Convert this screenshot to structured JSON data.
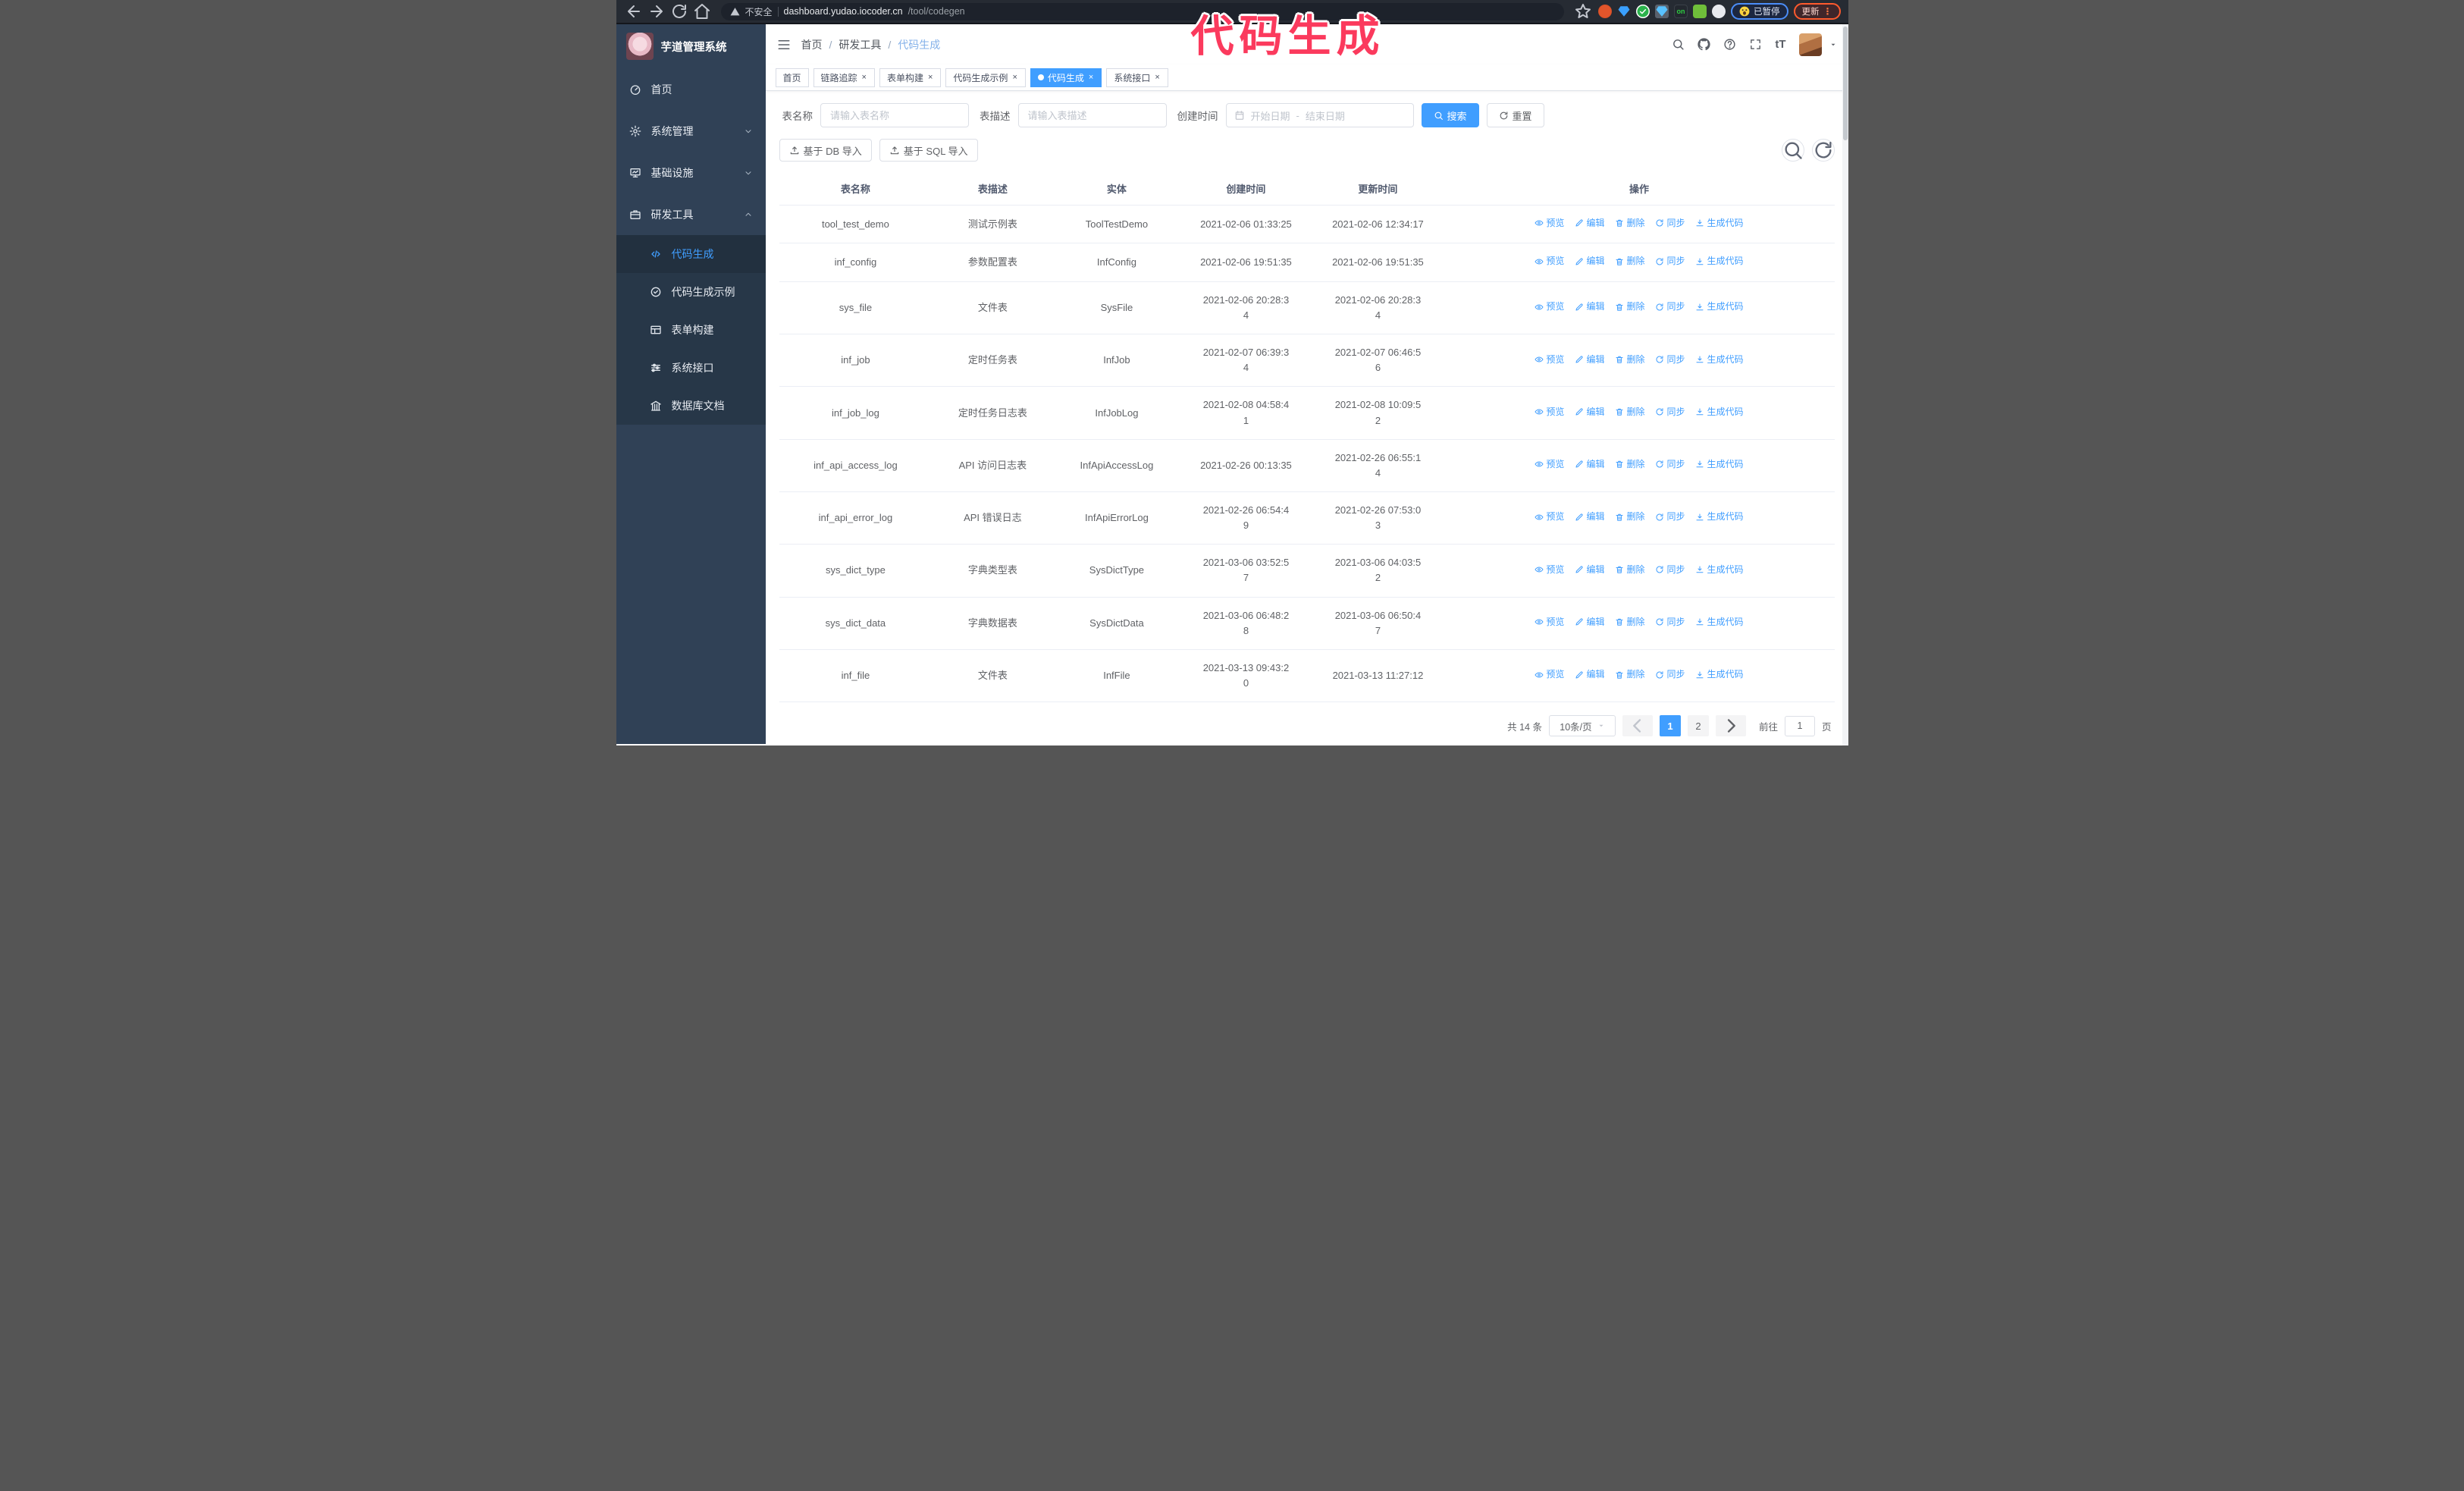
{
  "browser": {
    "insecure_label": "不安全",
    "url_host": "dashboard.yudao.iocoder.cn",
    "url_path": "/tool/codegen",
    "paused_label": "已暂停",
    "update_label": "更新"
  },
  "annotation": {
    "text": "代码生成",
    "color": "#fb3a5d"
  },
  "sidebar": {
    "title": "芋道管理系统",
    "menu": [
      {
        "key": "home",
        "icon": "dashboard-icon",
        "label": "首页",
        "chevron": ""
      },
      {
        "key": "system-management",
        "icon": "gear-icon",
        "label": "系统管理",
        "chevron": "down"
      },
      {
        "key": "infrastructure",
        "icon": "monitor-icon",
        "label": "基础设施",
        "chevron": "down"
      },
      {
        "key": "dev-tools",
        "icon": "toolbox-icon",
        "label": "研发工具",
        "chevron": "up"
      }
    ],
    "submenu": [
      {
        "key": "codegen",
        "icon": "code-icon",
        "label": "代码生成",
        "active": true
      },
      {
        "key": "codegen-example",
        "icon": "badge-check-icon",
        "label": "代码生成示例",
        "active": false
      },
      {
        "key": "form-builder",
        "icon": "form-table-icon",
        "label": "表单构建",
        "active": false
      },
      {
        "key": "system-api",
        "icon": "sliders-icon",
        "label": "系统接口",
        "active": false
      },
      {
        "key": "db-doc",
        "icon": "columns-icon",
        "label": "数据库文档",
        "active": false
      }
    ]
  },
  "navbar": {
    "breadcrumb": [
      "首页",
      "研发工具",
      "代码生成"
    ]
  },
  "tabs": [
    {
      "key": "home",
      "label": "首页",
      "closable": false,
      "active": false
    },
    {
      "key": "tracer",
      "label": "链路追踪",
      "closable": true,
      "active": false
    },
    {
      "key": "form-builder",
      "label": "表单构建",
      "closable": true,
      "active": false
    },
    {
      "key": "codegen-example",
      "label": "代码生成示例",
      "closable": true,
      "active": false
    },
    {
      "key": "codegen",
      "label": "代码生成",
      "closable": true,
      "active": true
    },
    {
      "key": "system-api",
      "label": "系统接口",
      "closable": true,
      "active": false
    }
  ],
  "filters": {
    "name_label": "表名称",
    "name_placeholder": "请输入表名称",
    "desc_label": "表描述",
    "desc_placeholder": "请输入表描述",
    "time_label": "创建时间",
    "start_placeholder": "开始日期",
    "range_separator": "-",
    "end_placeholder": "结束日期",
    "search_label": "搜索",
    "reset_label": "重置"
  },
  "toolbar": {
    "db_import_label": "基于 DB 导入",
    "sql_import_label": "基于 SQL 导入"
  },
  "table": {
    "headers": [
      "表名称",
      "表描述",
      "实体",
      "创建时间",
      "更新时间",
      "操作"
    ],
    "actions": [
      {
        "icon": "eye-icon",
        "label": "预览"
      },
      {
        "icon": "edit-icon",
        "label": "编辑"
      },
      {
        "icon": "delete-icon",
        "label": "删除"
      },
      {
        "icon": "sync-icon",
        "label": "同步"
      },
      {
        "icon": "download-icon",
        "label": "生成代码"
      }
    ],
    "rows": [
      {
        "name": "tool_test_demo",
        "desc": "测试示例表",
        "entity": "ToolTestDemo",
        "create_time": "2021-02-06 01:33:25",
        "create_wrap": false,
        "update_time": "2021-02-06 12:34:17",
        "update_wrap": false
      },
      {
        "name": "inf_config",
        "desc": "参数配置表",
        "entity": "InfConfig",
        "create_time": "2021-02-06 19:51:35",
        "create_wrap": false,
        "update_time": "2021-02-06 19:51:35",
        "update_wrap": false
      },
      {
        "name": "sys_file",
        "desc": "文件表",
        "entity": "SysFile",
        "create_time": "2021-02-06 20:28:34",
        "create_wrap": true,
        "update_time": "2021-02-06 20:28:34",
        "update_wrap": true
      },
      {
        "name": "inf_job",
        "desc": "定时任务表",
        "entity": "InfJob",
        "create_time": "2021-02-07 06:39:34",
        "create_wrap": true,
        "update_time": "2021-02-07 06:46:56",
        "update_wrap": true
      },
      {
        "name": "inf_job_log",
        "desc": "定时任务日志表",
        "entity": "InfJobLog",
        "create_time": "2021-02-08 04:58:41",
        "create_wrap": true,
        "update_time": "2021-02-08 10:09:52",
        "update_wrap": true
      },
      {
        "name": "inf_api_access_log",
        "desc": "API 访问日志表",
        "entity": "InfApiAccessLog",
        "create_time": "2021-02-26 00:13:35",
        "create_wrap": false,
        "update_time": "2021-02-26 06:55:14",
        "update_wrap": true
      },
      {
        "name": "inf_api_error_log",
        "desc": "API 错误日志",
        "entity": "InfApiErrorLog",
        "create_time": "2021-02-26 06:54:49",
        "create_wrap": true,
        "update_time": "2021-02-26 07:53:03",
        "update_wrap": true
      },
      {
        "name": "sys_dict_type",
        "desc": "字典类型表",
        "entity": "SysDictType",
        "create_time": "2021-03-06 03:52:57",
        "create_wrap": true,
        "update_time": "2021-03-06 04:03:52",
        "update_wrap": true
      },
      {
        "name": "sys_dict_data",
        "desc": "字典数据表",
        "entity": "SysDictData",
        "create_time": "2021-03-06 06:48:28",
        "create_wrap": true,
        "update_time": "2021-03-06 06:50:47",
        "update_wrap": true
      },
      {
        "name": "inf_file",
        "desc": "文件表",
        "entity": "InfFile",
        "create_time": "2021-03-13 09:43:20",
        "create_wrap": true,
        "update_time": "2021-03-13 11:27:12",
        "update_wrap": false
      }
    ]
  },
  "pagination": {
    "total_label": "共 14 条",
    "page_size_label": "10条/页",
    "pages": [
      "1",
      "2"
    ],
    "active_page": "1",
    "goto_label": "前往",
    "goto_value": "1",
    "page_unit_label": "页"
  }
}
